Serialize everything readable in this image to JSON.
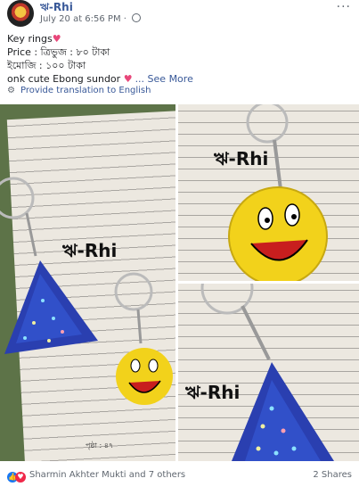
{
  "header": {
    "page_name": "ঋ-Rhi",
    "timestamp": "July 20 at 6:56 PM",
    "dot": "·",
    "more_label": "···"
  },
  "post": {
    "line1": "Key rings",
    "line2": "Price : ত্রিভুজ : ৮০ টাকা",
    "line3": "ইমোজি : ১০০ টাকা",
    "line4": "onk cute Ebong sundor",
    "see_more": "... See More",
    "translate": "Provide translation to English"
  },
  "photos": {
    "brand": "ঋ-Rhi",
    "page_number": "পৃষ্ঠা : ৪৭"
  },
  "footer": {
    "reactions": "Sharmin Akhter Mukti and 7 others",
    "shares": "2 Shares"
  },
  "colors": {
    "link": "#385898",
    "secondary": "#606770",
    "emoji_yellow": "#f2d21b",
    "triangle_blue": "#2a3fb0"
  }
}
